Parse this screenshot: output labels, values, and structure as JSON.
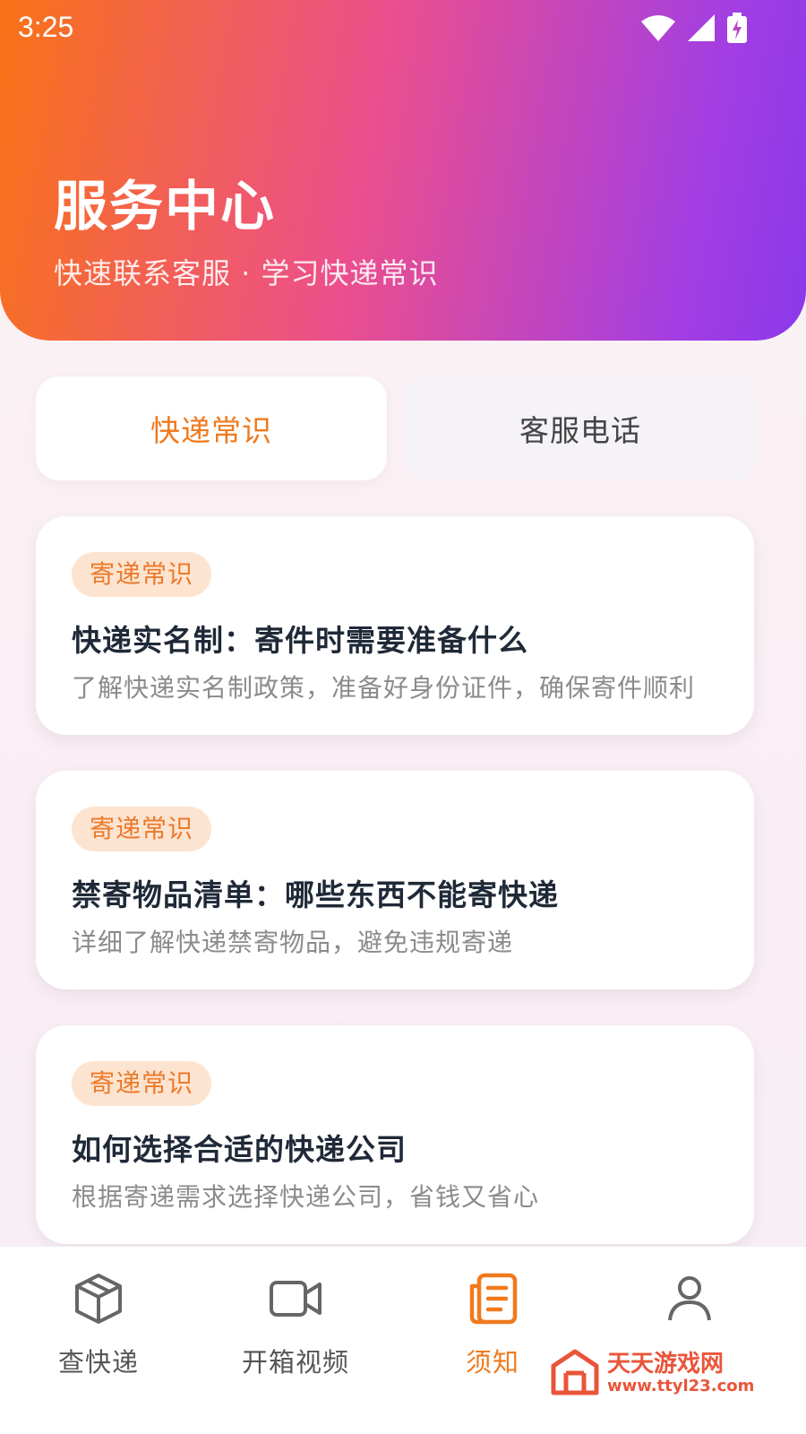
{
  "status_bar": {
    "time": "3:25"
  },
  "header": {
    "title": "服务中心",
    "subtitle": "快速联系客服 · 学习快递常识"
  },
  "tabs": [
    {
      "label": "快递常识",
      "active": true
    },
    {
      "label": "客服电话",
      "active": false
    }
  ],
  "articles": [
    {
      "badge": "寄递常识",
      "title": "快递实名制：寄件时需要准备什么",
      "description": "了解快递实名制政策，准备好身份证件，确保寄件顺利"
    },
    {
      "badge": "寄递常识",
      "title": "禁寄物品清单：哪些东西不能寄快递",
      "description": "详细了解快递禁寄物品，避免违规寄递"
    },
    {
      "badge": "寄递常识",
      "title": "如何选择合适的快递公司",
      "description": "根据寄递需求选择快递公司，省钱又省心"
    }
  ],
  "bottom_nav": [
    {
      "label": "查快递",
      "icon": "package-icon",
      "active": false
    },
    {
      "label": "开箱视频",
      "icon": "video-icon",
      "active": false
    },
    {
      "label": "须知",
      "icon": "document-icon",
      "active": true
    },
    {
      "label": "",
      "icon": "user-icon",
      "active": false
    }
  ],
  "watermark": {
    "name": "天天游戏网",
    "url": "www.ttyl23.com"
  },
  "colors": {
    "accent": "#f07a1e",
    "header_gradient_start": "#f97316",
    "header_gradient_end": "#8b38ea",
    "badge_bg": "#fde4d0"
  }
}
